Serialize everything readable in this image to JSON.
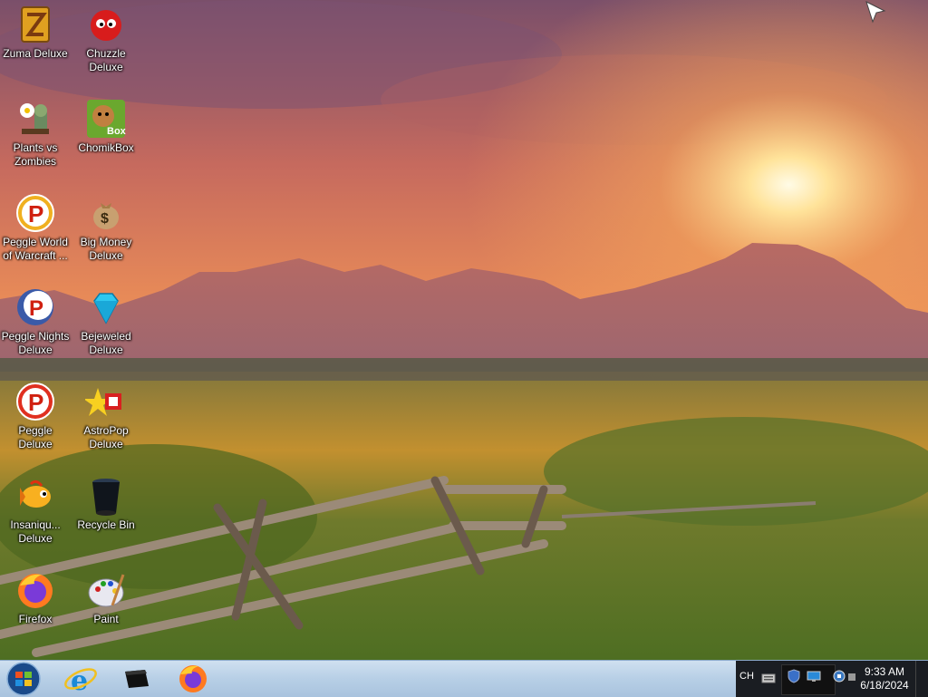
{
  "desktop": {
    "icons": [
      {
        "label": "Zuma Deluxe",
        "icon": "zuma-icon"
      },
      {
        "label": "Chuzzle Deluxe",
        "icon": "chuzzle-icon"
      },
      {
        "label": "Plants vs Zombies",
        "icon": "plants-vs-zombies-icon"
      },
      {
        "label": "ChomikBox",
        "icon": "chomikbox-icon"
      },
      {
        "label": "Peggle World of Warcraft ...",
        "icon": "peggle-icon"
      },
      {
        "label": "Big Money Deluxe",
        "icon": "money-bag-icon"
      },
      {
        "label": "Peggle Nights Deluxe",
        "icon": "peggle-nights-icon"
      },
      {
        "label": "Bejeweled Deluxe",
        "icon": "diamond-icon"
      },
      {
        "label": "Peggle Deluxe",
        "icon": "peggle-icon"
      },
      {
        "label": "AstroPop Deluxe",
        "icon": "astropop-icon"
      },
      {
        "label": "Insaniqu... Deluxe",
        "icon": "fish-icon"
      },
      {
        "label": "Recycle Bin",
        "icon": "recycle-bin-icon"
      },
      {
        "label": "Firefox",
        "icon": "firefox-icon"
      },
      {
        "label": "Paint",
        "icon": "paint-palette-icon"
      }
    ],
    "chomik_badge": "Box",
    "big_money_symbol": "$"
  },
  "taskbar": {
    "pinned": [
      {
        "icon": "internet-explorer-icon"
      },
      {
        "icon": "console-icon"
      },
      {
        "icon": "firefox-icon"
      }
    ],
    "tray": {
      "language": "CH",
      "time": "9:33 AM",
      "date": "6/18/2024"
    }
  },
  "colors": {
    "taskbar": "#b7cfe6",
    "tray": "#1a1d22",
    "sky_top": "#6b4a6e",
    "sky_glow": "#f3a65a"
  }
}
